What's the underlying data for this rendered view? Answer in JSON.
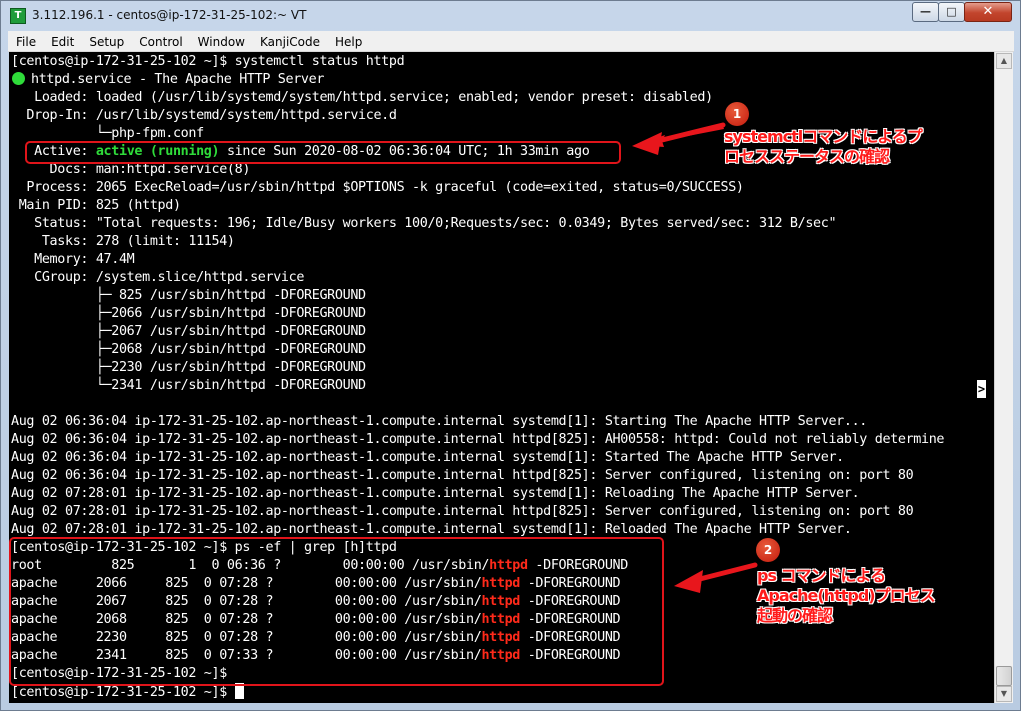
{
  "window": {
    "title": "3.112.196.1 - centos@ip-172-31-25-102:~ VT",
    "app_icon": "T",
    "min_glyph": "—",
    "max_glyph": "□",
    "close_glyph": "✕"
  },
  "menu": [
    "File",
    "Edit",
    "Setup",
    "Control",
    "Window",
    "KanjiCode",
    "Help"
  ],
  "terminal": {
    "lines": [
      "[centos@ip-172-31-25-102 ~]$ systemctl status httpd",
      "httpd.service - The Apache HTTP Server",
      "   Loaded: loaded (/usr/lib/systemd/system/httpd.service; enabled; vendor preset: disabled)",
      "  Drop-In: /usr/lib/systemd/system/httpd.service.d",
      "           └─php-fpm.conf",
      "   Active: ",
      "     Docs: man:httpd.service(8)",
      "  Process: 2065 ExecReload=/usr/sbin/httpd $OPTIONS -k graceful (code=exited, status=0/SUCCESS)",
      " Main PID: 825 (httpd)",
      "   Status: \"Total requests: 196; Idle/Busy workers 100/0;Requests/sec: 0.0349; Bytes served/sec: 312 B/sec\"",
      "    Tasks: 278 (limit: 11154)",
      "   Memory: 47.4M",
      "   CGroup: /system.slice/httpd.service",
      "           ├─ 825 /usr/sbin/httpd -DFOREGROUND",
      "           ├─2066 /usr/sbin/httpd -DFOREGROUND",
      "           ├─2067 /usr/sbin/httpd -DFOREGROUND",
      "           ├─2068 /usr/sbin/httpd -DFOREGROUND",
      "           ├─2230 /usr/sbin/httpd -DFOREGROUND",
      "           └─2341 /usr/sbin/httpd -DFOREGROUND",
      "",
      "Aug 02 06:36:04 ip-172-31-25-102.ap-northeast-1.compute.internal systemd[1]: Starting The Apache HTTP Server...",
      "Aug 02 06:36:04 ip-172-31-25-102.ap-northeast-1.compute.internal httpd[825]: AH00558: httpd: Could not reliably determine",
      "Aug 02 06:36:04 ip-172-31-25-102.ap-northeast-1.compute.internal systemd[1]: Started The Apache HTTP Server.",
      "Aug 02 06:36:04 ip-172-31-25-102.ap-northeast-1.compute.internal httpd[825]: Server configured, listening on: port 80",
      "Aug 02 07:28:01 ip-172-31-25-102.ap-northeast-1.compute.internal systemd[1]: Reloading The Apache HTTP Server.",
      "Aug 02 07:28:01 ip-172-31-25-102.ap-northeast-1.compute.internal httpd[825]: Server configured, listening on: port 80",
      "Aug 02 07:28:01 ip-172-31-25-102.ap-northeast-1.compute.internal systemd[1]: Reloaded The Apache HTTP Server.",
      "[centos@ip-172-31-25-102 ~]$ ps -ef | grep [h]ttpd"
    ],
    "active_status": "active (running)",
    "active_rest": " since Sun 2020-08-02 06:36:04 UTC; 1h 33min ago",
    "ps_rows": [
      {
        "pre": "root         825       1  0 06:36 ?        00:00:00 /usr/sbin/",
        "match": "httpd",
        "post": " -DFOREGROUND"
      },
      {
        "pre": "apache     2066     825  0 07:28 ?        00:00:00 /usr/sbin/",
        "match": "httpd",
        "post": " -DFOREGROUND"
      },
      {
        "pre": "apache     2067     825  0 07:28 ?        00:00:00 /usr/sbin/",
        "match": "httpd",
        "post": " -DFOREGROUND"
      },
      {
        "pre": "apache     2068     825  0 07:28 ?        00:00:00 /usr/sbin/",
        "match": "httpd",
        "post": " -DFOREGROUND"
      },
      {
        "pre": "apache     2230     825  0 07:28 ?        00:00:00 /usr/sbin/",
        "match": "httpd",
        "post": " -DFOREGROUND"
      },
      {
        "pre": "apache     2341     825  0 07:33 ?        00:00:00 /usr/sbin/",
        "match": "httpd",
        "post": " -DFOREGROUND"
      }
    ],
    "final_prompts": [
      "[centos@ip-172-31-25-102 ~]$",
      "[centos@ip-172-31-25-102 ~]$ "
    ],
    "trunc_marker": ">"
  },
  "annotations": {
    "callout_1": {
      "number": "1",
      "lines": [
        "systemctlコマンドによるプ",
        "ロセスステータスの確認"
      ]
    },
    "callout_2": {
      "number": "2",
      "lines": [
        "ps コマンドによる",
        "Apache(httpd)プロセス",
        "起動の確認"
      ]
    }
  },
  "colors": {
    "status_green": "#2fdc3a",
    "highlight_red": "#e0141a",
    "terminal_bg": "#000000"
  }
}
